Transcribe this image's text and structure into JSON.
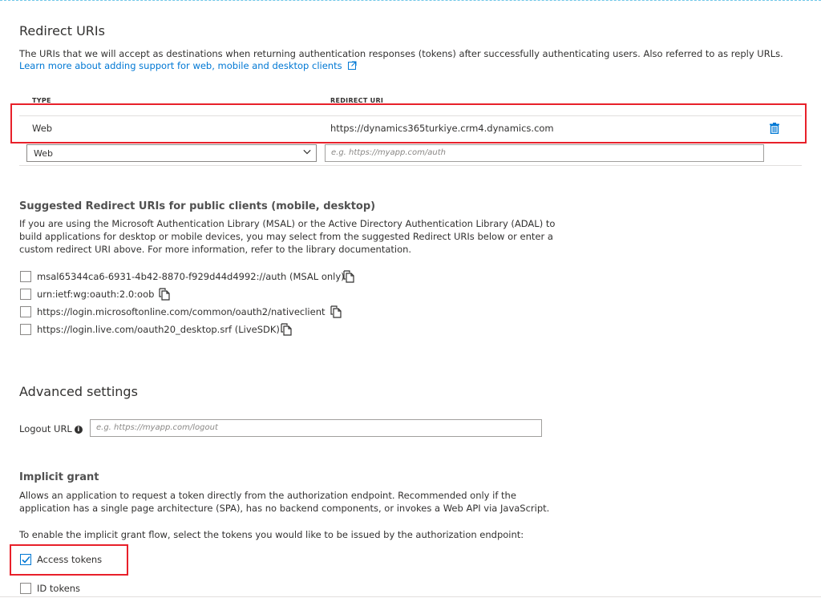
{
  "redirect": {
    "title": "Redirect URIs",
    "description": "The URIs that we will accept as destinations when returning authentication responses (tokens) after successfully authenticating users. Also referred to as reply URLs.",
    "learn_more": "Learn more about adding support for web, mobile and desktop clients",
    "col_type": "TYPE",
    "col_uri": "REDIRECT URI",
    "rows": [
      {
        "type": "Web",
        "uri": "https://dynamics365turkiye.crm4.dynamics.com"
      }
    ],
    "new_type_value": "Web",
    "new_uri_placeholder": "e.g. https://myapp.com/auth"
  },
  "suggested": {
    "title": "Suggested Redirect URIs for public clients (mobile, desktop)",
    "description_lines": [
      "If you are using the Microsoft Authentication Library (MSAL) or the Active Directory Authentication Library (ADAL) to",
      "build applications for desktop or mobile devices, you may select from the suggested Redirect URIs below or enter a",
      "custom redirect URI above. For more information, refer to the library documentation."
    ],
    "options": [
      {
        "label": "msal65344ca6-6931-4b42-8870-f929d44d4992://auth (MSAL only)",
        "checked": false
      },
      {
        "label": "urn:ietf:wg:oauth:2.0:oob",
        "checked": false
      },
      {
        "label": "https://login.microsoftonline.com/common/oauth2/nativeclient",
        "checked": false
      },
      {
        "label": "https://login.live.com/oauth20_desktop.srf (LiveSDK)",
        "checked": false
      }
    ]
  },
  "advanced": {
    "title": "Advanced settings",
    "logout_label": "Logout URL",
    "logout_placeholder": "e.g. https://myapp.com/logout"
  },
  "implicit": {
    "title": "Implicit grant",
    "description_lines": [
      "Allows an application to request a token directly from the authorization endpoint. Recommended only if the",
      "application has a single page architecture (SPA), has no backend components, or invokes a Web API via JavaScript."
    ],
    "instruction": "To enable the implicit grant flow, select the tokens you would like to be issued by the authorization endpoint:",
    "tokens": [
      {
        "label": "Access tokens",
        "checked": true
      },
      {
        "label": "ID tokens",
        "checked": false
      }
    ]
  },
  "colors": {
    "accent": "#0078d4",
    "highlight": "#e8202a",
    "text": "#323130"
  }
}
